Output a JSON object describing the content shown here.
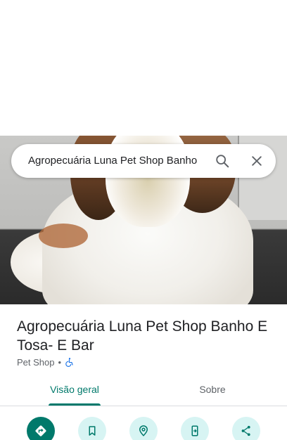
{
  "search": {
    "value": "Agropecuária Luna Pet Shop Banho"
  },
  "place": {
    "title": "Agropecuária Luna Pet Shop Banho E Tosa- E Bar",
    "category": "Pet Shop",
    "separator": "•",
    "accessibility_icon": "wheelchair-accessible-icon"
  },
  "tabs": [
    {
      "label": "Visão geral",
      "active": true
    },
    {
      "label": "Sobre",
      "active": false
    }
  ],
  "actions": [
    {
      "icon": "directions-icon"
    },
    {
      "icon": "bookmark-icon"
    },
    {
      "icon": "nearby-icon"
    },
    {
      "icon": "send-to-phone-icon"
    },
    {
      "icon": "share-icon"
    }
  ],
  "colors": {
    "accent": "#00796b",
    "action_bg": "#d7f4f3",
    "text_primary": "#202124",
    "text_secondary": "#5f6368",
    "accessibility_blue": "#1a73e8"
  }
}
